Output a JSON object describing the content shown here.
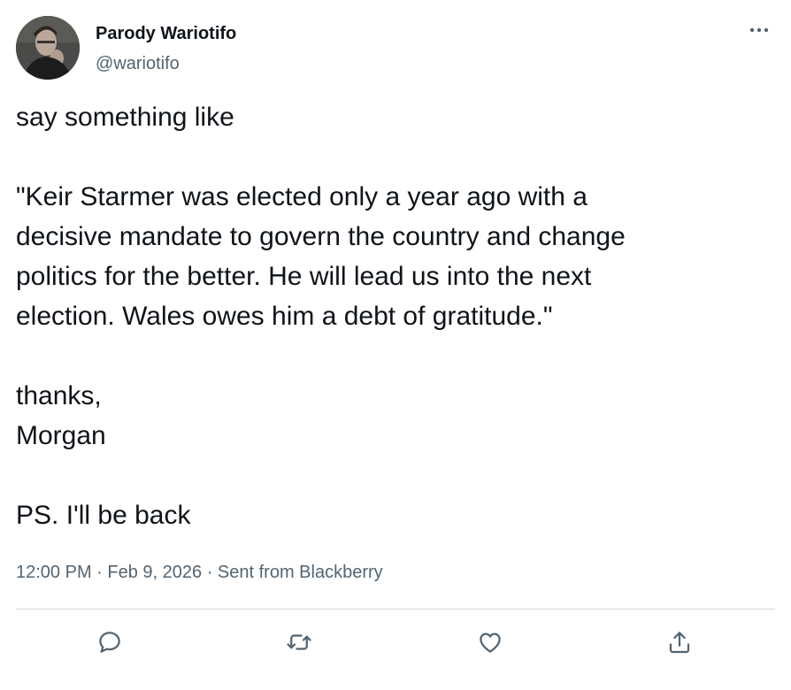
{
  "author": {
    "display_name": "Parody Wariotifo",
    "handle": "@wariotifo"
  },
  "more_icon": "more-horizontal-icon",
  "tweet": {
    "lines": [
      "say something like",
      "",
      "\"Keir Starmer was elected only a year ago with a",
      "decisive mandate to govern the country and change",
      "politics for the better. He will lead us into the next",
      "election. Wales owes him a debt of gratitude.\"",
      "",
      "thanks,",
      "Morgan",
      "",
      "PS. I'll be back"
    ]
  },
  "meta": {
    "time": "12:00 PM",
    "separator1": " · ",
    "date": "Feb 9, 2026",
    "separator2": " · ",
    "source": "Sent from Blackberry"
  },
  "actions": [
    {
      "name": "reply",
      "icon": "reply-icon"
    },
    {
      "name": "retweet",
      "icon": "retweet-icon"
    },
    {
      "name": "like",
      "icon": "heart-icon"
    },
    {
      "name": "share",
      "icon": "share-icon"
    }
  ],
  "colors": {
    "text_primary": "#0f1419",
    "text_secondary": "#536471",
    "divider": "#cfd9de"
  }
}
